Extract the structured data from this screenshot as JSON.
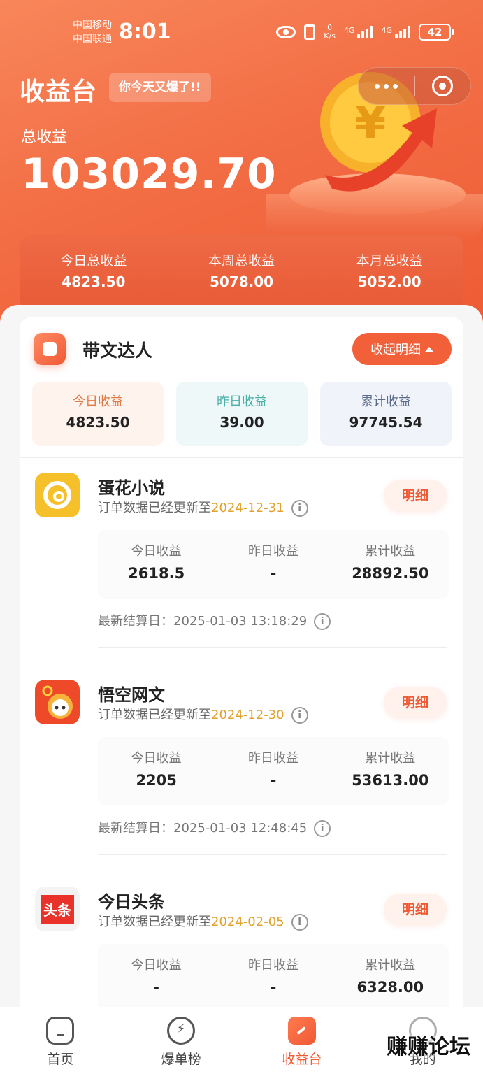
{
  "status_bar": {
    "carrier1": "中国移动",
    "carrier2": "中国联通",
    "time": "8:01",
    "speed_value": "0",
    "speed_unit": "K/s",
    "network1": "4G",
    "network2": "4G",
    "battery": "42"
  },
  "header": {
    "title": "收益台",
    "badge": "你今天又爆了!!",
    "total_label": "总收益",
    "total_value": "103029.70"
  },
  "summary": [
    {
      "label": "今日总收益",
      "value": "4823.50"
    },
    {
      "label": "本周总收益",
      "value": "5078.00"
    },
    {
      "label": "本月总收益",
      "value": "5052.00"
    }
  ],
  "daren": {
    "title": "带文达人",
    "collapse_label": "收起明细",
    "stats": [
      {
        "label": "今日收益",
        "value": "4823.50",
        "label_color": "#e07a45",
        "bg": "#fff3ee"
      },
      {
        "label": "昨日收益",
        "value": "39.00",
        "label_color": "#4bb0a8",
        "bg": "#eef8f8"
      },
      {
        "label": "累计收益",
        "value": "97745.54",
        "label_color": "#5a6b8a",
        "bg": "#f0f3f9"
      }
    ]
  },
  "platforms": [
    {
      "name": "蛋花小说",
      "update_prefix": "订单数据已经更新至",
      "update_date": "2024-12-31",
      "detail_label": "明细",
      "stats": [
        {
          "label": "今日收益",
          "value": "2618.5"
        },
        {
          "label": "昨日收益",
          "value": "-"
        },
        {
          "label": "累计收益",
          "value": "28892.50"
        }
      ],
      "settle": "最新结算日：2025-01-03 13:18:29"
    },
    {
      "name": "悟空网文",
      "update_prefix": "订单数据已经更新至",
      "update_date": "2024-12-30",
      "detail_label": "明细",
      "stats": [
        {
          "label": "今日收益",
          "value": "2205"
        },
        {
          "label": "昨日收益",
          "value": "-"
        },
        {
          "label": "累计收益",
          "value": "53613.00"
        }
      ],
      "settle": "最新结算日：2025-01-03 12:48:45"
    },
    {
      "name": "今日头条",
      "icon_text": "头条",
      "update_prefix": "订单数据已经更新至",
      "update_date": "2024-02-05",
      "detail_label": "明细",
      "stats": [
        {
          "label": "今日收益",
          "value": "-"
        },
        {
          "label": "昨日收益",
          "value": "-"
        },
        {
          "label": "累计收益",
          "value": "6328.00"
        }
      ]
    }
  ],
  "nav": [
    {
      "label": "首页",
      "icon": "home-icon"
    },
    {
      "label": "爆单榜",
      "icon": "flash-badge-icon"
    },
    {
      "label": "收益台",
      "icon": "income-icon"
    },
    {
      "label": "我的",
      "icon": "profile-icon"
    }
  ],
  "watermark": "赚赚论坛",
  "colors": {
    "brand": "#f05a35",
    "date_highlight": "#e0a02a"
  }
}
